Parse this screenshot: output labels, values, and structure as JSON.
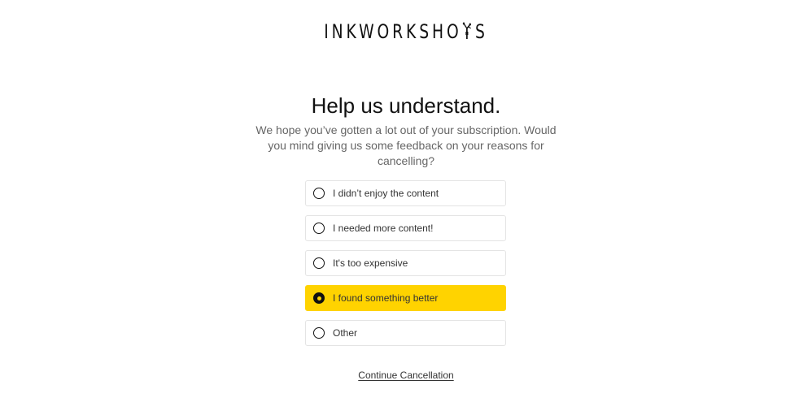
{
  "brand": {
    "logo_before": "INKWORKSHO",
    "logo_after": "S",
    "logo_icon": "pen-nib-icon"
  },
  "main": {
    "title": "Help us understand.",
    "subtitle": "We hope you’ve gotten a lot out of your subscription. Would you mind giving us some feedback on your reasons for cancelling?"
  },
  "options": [
    {
      "label": "I didn’t enjoy the content",
      "selected": false
    },
    {
      "label": "I needed more content!",
      "selected": false
    },
    {
      "label": "It's too expensive",
      "selected": false
    },
    {
      "label": "I found something better",
      "selected": true
    },
    {
      "label": "Other",
      "selected": false
    }
  ],
  "actions": {
    "continue_label": "Continue Cancellation"
  },
  "colors": {
    "accent": "#ffd300",
    "text": "#111111",
    "muted": "#666666",
    "border": "#e4e4e4"
  }
}
